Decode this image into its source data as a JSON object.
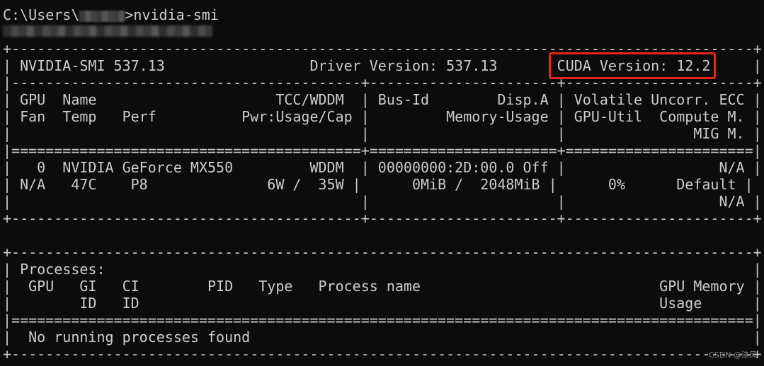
{
  "prompt": {
    "path_prefix": "C:\\Users\\",
    "command": ">nvidia-smi"
  },
  "lines": [
    "+---------------------------------------------------------------------------------------+",
    "| NVIDIA-SMI 537.13                 Driver Version: 537.13       CUDA Version: 12.2     |",
    "|-----------------------------------------+----------------------+----------------------+",
    "| GPU  Name                     TCC/WDDM  | Bus-Id        Disp.A | Volatile Uncorr. ECC |",
    "| Fan  Temp   Perf          Pwr:Usage/Cap |         Memory-Usage | GPU-Util  Compute M. |",
    "|                                         |                      |               MIG M. |",
    "|=========================================+======================+======================|",
    "|   0  NVIDIA GeForce MX550         WDDM  | 00000000:2D:00.0 Off |                  N/A |",
    "| N/A   47C    P8              6W /  35W |      0MiB /  2048MiB |      0%      Default |",
    "|                                         |                      |                  N/A |",
    "+-----------------------------------------+----------------------+----------------------+",
    "",
    "+---------------------------------------------------------------------------------------+",
    "| Processes:                                                                            |",
    "|  GPU   GI   CI        PID   Type   Process name                            GPU Memory |",
    "|        ID   ID                                                             Usage      |",
    "|=======================================================================================|",
    "|  No running processes found                                                           |",
    "+---------------------------------------------------------------------------------------+"
  ],
  "watermark": "CSDN @涤风"
}
